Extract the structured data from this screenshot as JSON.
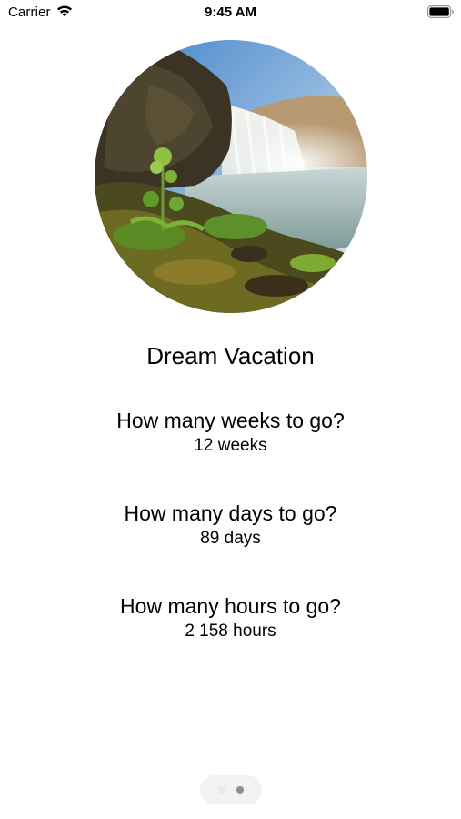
{
  "status_bar": {
    "carrier": "Carrier",
    "time": "9:45 AM",
    "icons": [
      "wifi-icon",
      "battery-icon"
    ]
  },
  "hero": {
    "image": "waterfall-landscape"
  },
  "title": "Dream Vacation",
  "questions": [
    {
      "question": "How many weeks to go?",
      "answer": "12 weeks"
    },
    {
      "question": "How many days to go?",
      "answer": "89 days"
    },
    {
      "question": "How many hours to go?",
      "answer": "2 158 hours"
    }
  ],
  "page_control": {
    "pages": 2,
    "current_page": 2
  },
  "colors": {
    "background": "#ffffff",
    "text": "#000000",
    "page_indicator_bg": "#f2f2f4",
    "active_dot": "#8e8e93",
    "inactive_dot": "#e9e9eb"
  }
}
